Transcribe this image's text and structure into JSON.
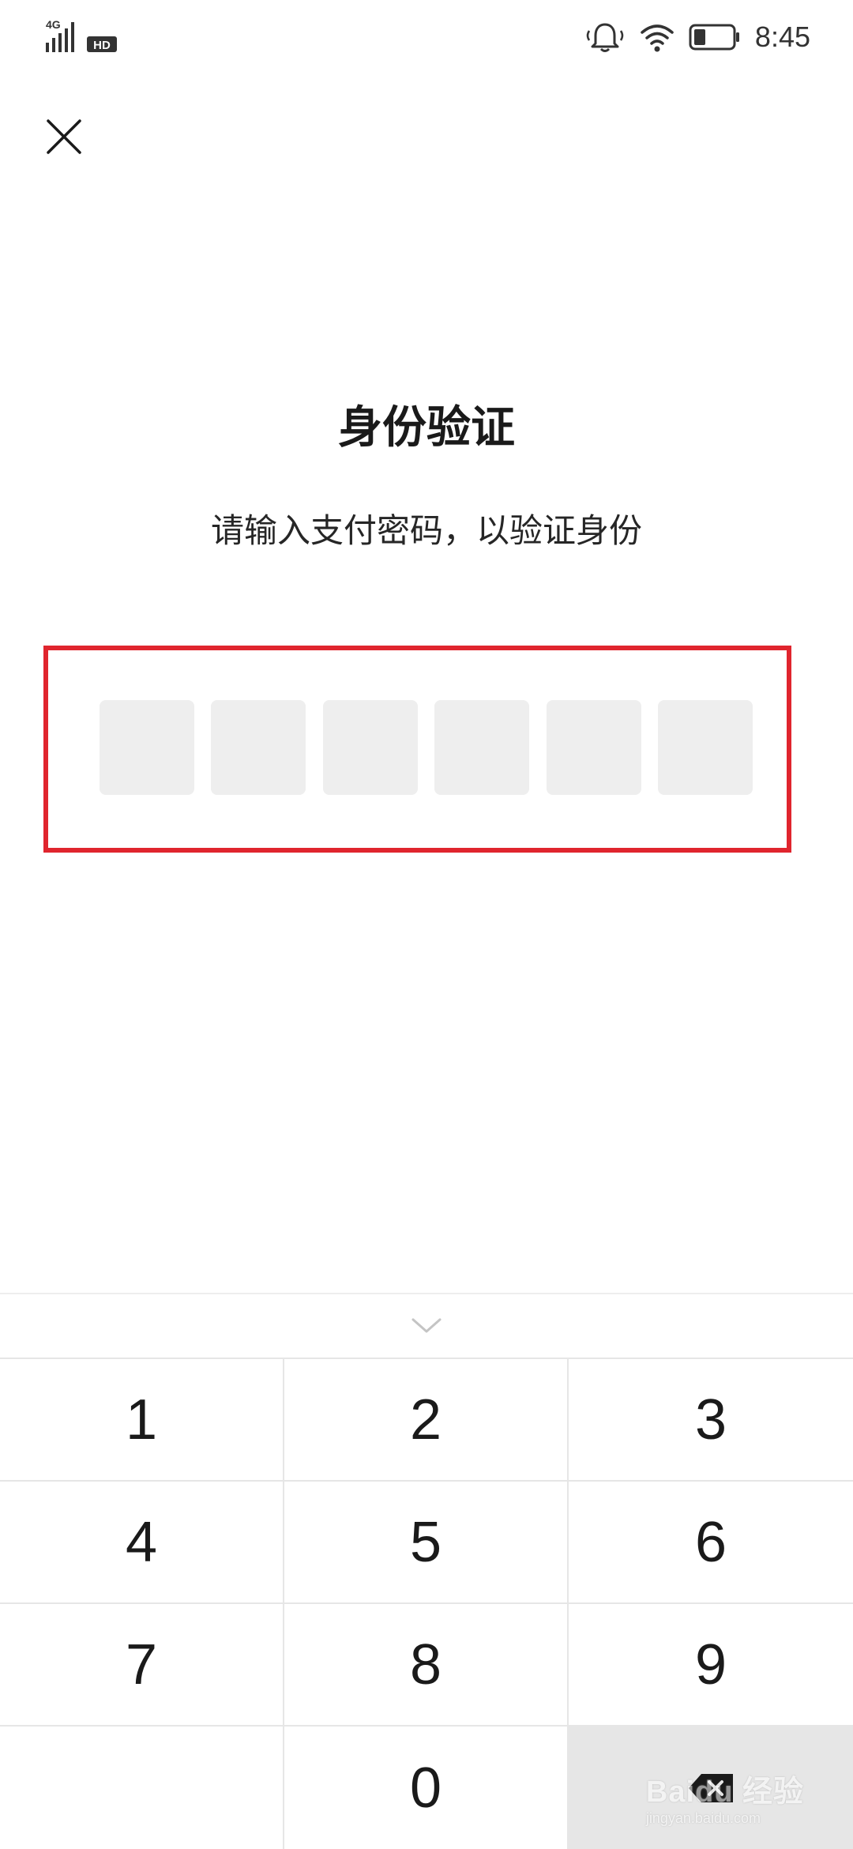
{
  "status_bar": {
    "network": "4G",
    "hd_label": "HD",
    "time": "8:45",
    "icons": [
      "signal-icon",
      "hd-icon",
      "bell-vibrate-icon",
      "wifi-icon",
      "battery-icon"
    ]
  },
  "close_icon": "close-icon",
  "title": "身份验证",
  "subtitle": "请输入支付密码，以验证身份",
  "pin": {
    "length": 6,
    "entered": 0
  },
  "keyboard": {
    "collapse_icon": "chevron-down-icon",
    "keys": [
      "1",
      "2",
      "3",
      "4",
      "5",
      "6",
      "7",
      "8",
      "9",
      "",
      "0",
      "delete"
    ],
    "delete_icon": "backspace-icon"
  },
  "watermark": {
    "main": "Baidu 经验",
    "sub": "jingyan.baidu.com"
  },
  "colors": {
    "highlight": "#e0252e",
    "pin_cell": "#eeeeee",
    "delete_key_bg": "#e6e6e6"
  }
}
